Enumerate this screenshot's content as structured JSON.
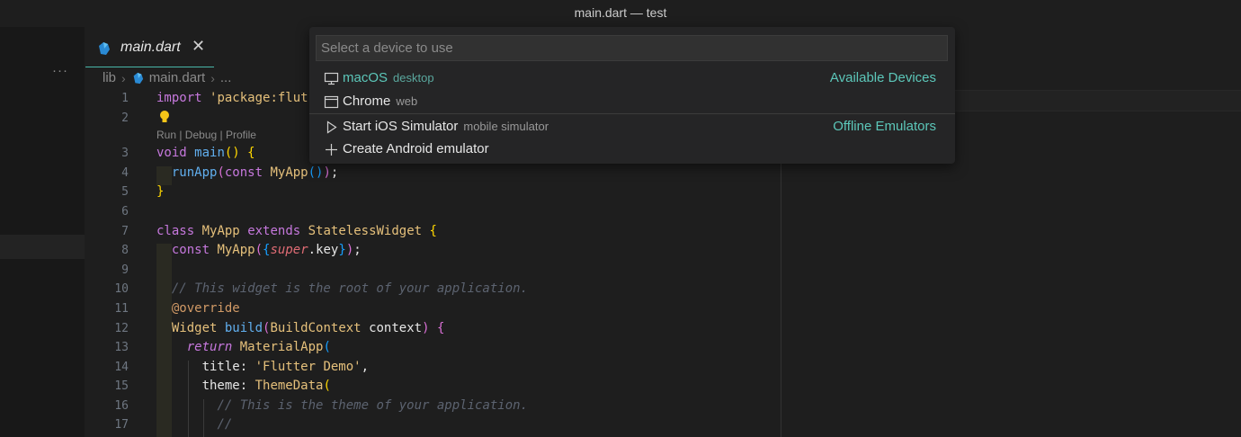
{
  "window": {
    "title": "main.dart — test"
  },
  "sidebar": {
    "more_label": "···"
  },
  "tab": {
    "label": "main.dart",
    "close_label": "✕"
  },
  "breadcrumb": {
    "folder": "lib",
    "file": "main.dart",
    "more": "..."
  },
  "codelens": "Run | Debug | Profile",
  "line_numbers": [
    "1",
    "2",
    "3",
    "4",
    "5",
    "6",
    "7",
    "8",
    "9",
    "10",
    "11",
    "12",
    "13",
    "14",
    "15",
    "16",
    "17"
  ],
  "code": {
    "l1_import": "import",
    "l1_str": "'package:flut",
    "l3_void": "void",
    "l3_main": "main",
    "l4_runapp": "runApp",
    "l4_const": "const",
    "l4_myapp": "MyApp",
    "l7_class": "class",
    "l7_myapp": "MyApp",
    "l7_extends": "extends",
    "l7_widget": "StatelessWidget",
    "l8_const": "const",
    "l8_myapp": "MyApp",
    "l8_super": "super",
    "l8_key": "key",
    "l10_comment": "// This widget is the root of your application.",
    "l11_override": "@override",
    "l12_widget": "Widget",
    "l12_build": "build",
    "l12_ctx_type": "BuildContext",
    "l12_ctx": "context",
    "l13_return": "return",
    "l13_material": "MaterialApp",
    "l14_title": "title",
    "l14_str": "'Flutter Demo'",
    "l15_theme": "theme",
    "l15_themedata": "ThemeData",
    "l16_comment": "// This is the theme of your application.",
    "l17_comment": "//"
  },
  "quickpick": {
    "placeholder": "Select a device to use",
    "items": [
      {
        "label": "macOS",
        "description": "desktop",
        "icon": "monitor-icon",
        "group": "Available Devices"
      },
      {
        "label": "Chrome",
        "description": "web",
        "icon": "browser-window-icon",
        "group": ""
      },
      {
        "label": "Start iOS Simulator",
        "description": "mobile simulator",
        "icon": "play-icon",
        "group": "Offline Emulators"
      },
      {
        "label": "Create Android emulator",
        "description": "",
        "icon": "plus-icon",
        "group": ""
      }
    ]
  },
  "colors": {
    "accent": "#5cc7b9",
    "background": "#1e1e1e",
    "panel": "#252526"
  }
}
